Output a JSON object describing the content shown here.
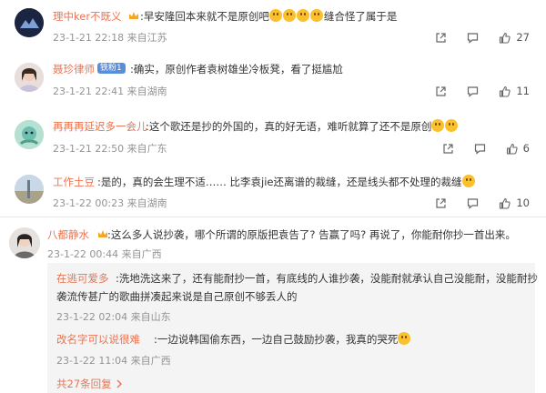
{
  "comments": [
    {
      "name": "理中ker不既义",
      "text_after_name": ":早安隆回本来就不是原创吧",
      "text_tail": "缝合怪了属于是",
      "meta": "23-1-21 22:18 来自江苏",
      "like_count": "27",
      "comment_count": ""
    },
    {
      "name": "聂珍律师",
      "badge": "铁粉1",
      "text_after_name": ":确实，原创作者袁树雄坐冷板凳，看了挺尴尬",
      "meta": "23-1-21 22:41 来自湖南",
      "like_count": "11"
    },
    {
      "name": "再再再延迟多一会儿",
      "text_after_name": ":这个歌还是抄的外国的，真的好无语，难听就算了还不是原创",
      "meta": "23-1-21 22:50 来自广东",
      "like_count": "6"
    },
    {
      "name": "工作土豆",
      "text_after_name": ":是的，真的会生理不适…… 比李袁jie还离谱的裁缝，还是线头都不处理的裁缝",
      "meta": "23-1-22 00:23 来自湖南",
      "like_count": "10"
    },
    {
      "name": "八都静水",
      "text_after_name": ":这么多人说抄袭，哪个所谓的原版把袁告了? 告赢了吗? 再说了，你能耐你抄一首出来。",
      "meta": "23-1-22 00:44 来自广西",
      "like_count": ""
    }
  ],
  "replies": [
    {
      "name": "在逃可爱多",
      "line1": ":洗地洗这来了，还有能耐抄一首，有底线的人谁抄袭，没能耐就承认自己没能耐，没能耐抄",
      "line2": "袭流传甚广的歌曲拼凑起来说是自己原创不够丢人的",
      "meta": "23-1-22 02:04 来自山东"
    },
    {
      "name": "改名字可以说很难",
      "text_after_name": ":一边说韩国偷东西，一边自己鼓励抄袭，我真的哭死",
      "meta": "23-1-22 11:04 来自广西"
    }
  ],
  "more_replies_label": "共27条回复",
  "icons": {
    "share": "share-icon",
    "comment": "comment-icon",
    "like": "thumbs-up-icon",
    "crown": "crown-badge-icon",
    "more": "chevron-right-icon"
  },
  "colors": {
    "username": "#eb7350",
    "text": "#333333",
    "meta": "#939393",
    "reply_bg": "#f4f4f4"
  }
}
